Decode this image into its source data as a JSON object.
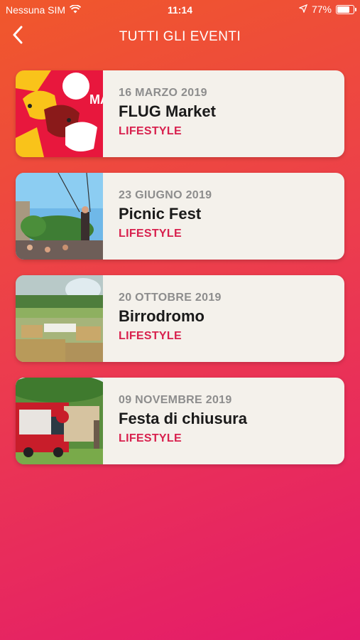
{
  "status_bar": {
    "carrier": "Nessuna SIM",
    "time": "11:14",
    "battery_percent": "77%",
    "battery_level": 0.77,
    "wifi_icon": "wifi-icon",
    "location_icon": "location-arrow-icon"
  },
  "nav": {
    "title": "TUTTI GLI EVENTI",
    "back_icon": "chevron-left-icon"
  },
  "events": [
    {
      "date": "16 MARZO 2019",
      "title": "FLUG Market",
      "category": "LIFESTYLE",
      "image": "flug-market-poster",
      "poster_text": "MA"
    },
    {
      "date": "23 GIUGNO 2019",
      "title": "Picnic Fest",
      "category": "LIFESTYLE",
      "image": "picnic-fest-photo"
    },
    {
      "date": "20 OTTOBRE 2019",
      "title": "Birrodromo",
      "category": "LIFESTYLE",
      "image": "birrodromo-photo"
    },
    {
      "date": "09 NOVEMBRE 2019",
      "title": "Festa di chiusura",
      "category": "LIFESTYLE",
      "image": "festa-chiusura-photo"
    }
  ],
  "colors": {
    "gradient_start": "#f0582b",
    "gradient_end": "#e41a6b",
    "card_bg": "#f4f1eb",
    "category": "#d8214e",
    "date": "#8d8d8d"
  }
}
